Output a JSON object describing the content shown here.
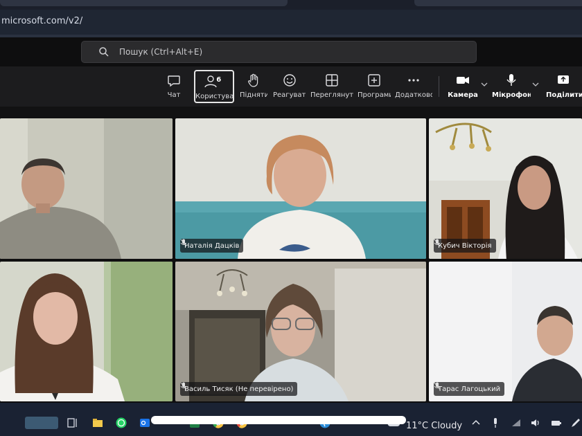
{
  "browser": {
    "url_fragment": "microsoft.com/v2/"
  },
  "header": {
    "search_placeholder": "Пошук (Ctrl+Alt+E)"
  },
  "toolbar": {
    "chat": "Чат",
    "people": "Користувачі",
    "people_count": "6",
    "raise": "Підняти",
    "react": "Реагувати",
    "view": "Переглянути",
    "apps": "Програми",
    "more": "Додатково",
    "camera": "Камера",
    "mic": "Мікрофон",
    "share": "Поділитися"
  },
  "participants": [
    {
      "name": ""
    },
    {
      "name": "Наталія Дацків"
    },
    {
      "name": "Кубич Вікторія"
    },
    {
      "name": ""
    },
    {
      "name": "Василь Тисяк (Не перевірено)"
    },
    {
      "name": "Тарас Лагоцький"
    }
  ],
  "taskbar": {
    "weather": "11°C  Cloudy"
  }
}
